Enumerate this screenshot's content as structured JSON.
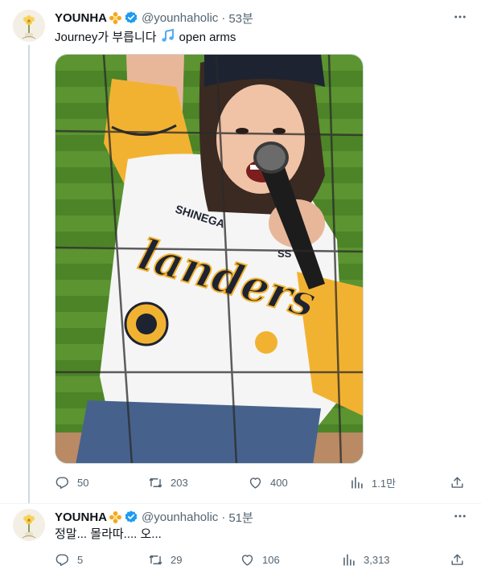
{
  "tweets": [
    {
      "name": "YOUNHA",
      "handle": "@younhaholic",
      "separator": "·",
      "time": "53분",
      "text_before": "Journey가 부릅니다",
      "text_after": "open arms",
      "media_text": [
        "SHINEGA",
        "landers",
        "SS"
      ],
      "actions": {
        "reply": "50",
        "retweet": "203",
        "like": "400",
        "views": "1.1만"
      }
    },
    {
      "name": "YOUNHA",
      "handle": "@younhaholic",
      "separator": "·",
      "time": "51분",
      "text": "정말... 몰라따.... 오...",
      "actions": {
        "reply": "5",
        "retweet": "29",
        "like": "106",
        "views": "3,313"
      }
    }
  ],
  "colors": {
    "verified": "#1d9bf0",
    "secondary": "#536471",
    "badge": "#f5a623",
    "jersey_yellow": "#f2b231",
    "field": "#4f8a2a"
  },
  "icons": [
    "more-icon",
    "verified-icon",
    "flower-badge-icon",
    "music-note-icon",
    "reply-icon",
    "retweet-icon",
    "like-icon",
    "views-icon",
    "share-icon"
  ]
}
